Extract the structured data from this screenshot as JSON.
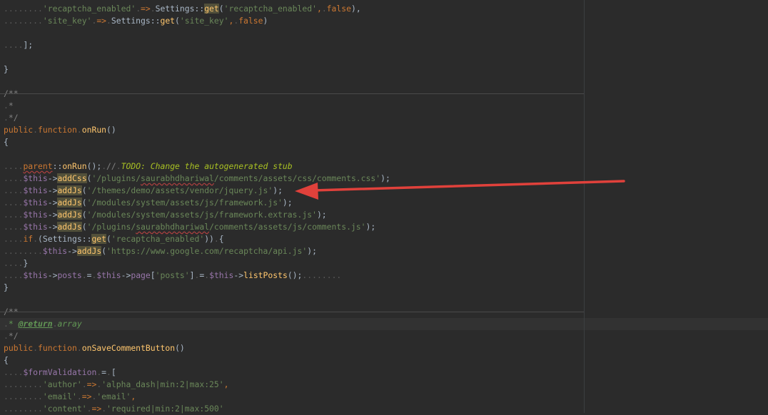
{
  "lines": [
    [
      [
        "ws",
        "........"
      ],
      [
        "str",
        "'recaptcha_enabled'"
      ],
      [
        "ws",
        "."
      ],
      [
        "kw",
        "=>"
      ],
      [
        "ws",
        "."
      ],
      [
        "def",
        "Settings::"
      ],
      [
        "fn hl",
        "get"
      ],
      [
        "def",
        "("
      ],
      [
        "str",
        "'recaptcha_enabled'"
      ],
      [
        "kw",
        ","
      ],
      [
        "ws",
        "."
      ],
      [
        "kw",
        "false"
      ],
      [
        "def",
        "),"
      ]
    ],
    [
      [
        "ws",
        "........"
      ],
      [
        "str",
        "'site_key'"
      ],
      [
        "ws",
        "."
      ],
      [
        "kw",
        "=>"
      ],
      [
        "ws",
        "."
      ],
      [
        "def",
        "Settings::"
      ],
      [
        "fn",
        "get"
      ],
      [
        "def",
        "("
      ],
      [
        "str",
        "'site_key'"
      ],
      [
        "kw",
        ","
      ],
      [
        "ws",
        "."
      ],
      [
        "kw",
        "false"
      ],
      [
        "def",
        ")"
      ]
    ],
    [],
    [
      [
        "ws",
        "...."
      ],
      [
        "def",
        "];"
      ]
    ],
    [],
    [
      [
        "def",
        "}"
      ]
    ],
    [],
    [
      [
        "cmt",
        "/**"
      ]
    ],
    [
      [
        "ws",
        "."
      ],
      [
        "cmt",
        "*"
      ]
    ],
    [
      [
        "ws",
        "."
      ],
      [
        "cmt",
        "*/"
      ]
    ],
    [
      [
        "kw",
        "public"
      ],
      [
        "ws",
        "."
      ],
      [
        "kw",
        "function"
      ],
      [
        "ws",
        "."
      ],
      [
        "fn",
        "onRun"
      ],
      [
        "def",
        "()"
      ]
    ],
    [
      [
        "def",
        "{"
      ]
    ],
    [],
    [
      [
        "ws",
        "...."
      ],
      [
        "kw typo",
        "parent"
      ],
      [
        "def",
        "::"
      ],
      [
        "fn",
        "onRun"
      ],
      [
        "def",
        "();"
      ],
      [
        "ws",
        "."
      ],
      [
        "cmt",
        "//"
      ],
      [
        "ws",
        "."
      ],
      [
        "todo",
        "TODO: Change the autogenerated stub"
      ]
    ],
    [
      [
        "ws",
        "...."
      ],
      [
        "var",
        "$this"
      ],
      [
        "def",
        "->"
      ],
      [
        "fn hl",
        "addCss"
      ],
      [
        "def",
        "("
      ],
      [
        "str",
        "'/plugins/"
      ],
      [
        "str typo",
        "saurabhdhariwal"
      ],
      [
        "str",
        "/comments/assets/css/comments.css'"
      ],
      [
        "def",
        ");"
      ]
    ],
    [
      [
        "ws",
        "...."
      ],
      [
        "var",
        "$this"
      ],
      [
        "def",
        "->"
      ],
      [
        "fn hl",
        "addJs"
      ],
      [
        "def",
        "("
      ],
      [
        "str",
        "'/themes/demo/assets/vendor/jquery.js'"
      ],
      [
        "def",
        ");"
      ]
    ],
    [
      [
        "ws",
        "...."
      ],
      [
        "var",
        "$this"
      ],
      [
        "def",
        "->"
      ],
      [
        "fn hl",
        "addJs"
      ],
      [
        "def",
        "("
      ],
      [
        "str",
        "'/modules/system/assets/js/framework.js'"
      ],
      [
        "def",
        ");"
      ]
    ],
    [
      [
        "ws",
        "...."
      ],
      [
        "var",
        "$this"
      ],
      [
        "def",
        "->"
      ],
      [
        "fn hl",
        "addJs"
      ],
      [
        "def",
        "("
      ],
      [
        "str",
        "'/modules/system/assets/js/framework.extras.js'"
      ],
      [
        "def",
        ");"
      ]
    ],
    [
      [
        "ws",
        "...."
      ],
      [
        "var",
        "$this"
      ],
      [
        "def",
        "->"
      ],
      [
        "fn hl",
        "addJs"
      ],
      [
        "def",
        "("
      ],
      [
        "str",
        "'/plugins/"
      ],
      [
        "str typo",
        "saurabhdhariwal"
      ],
      [
        "str",
        "/comments/assets/js/comments.js'"
      ],
      [
        "def",
        ");"
      ]
    ],
    [
      [
        "ws",
        "...."
      ],
      [
        "kw",
        "if"
      ],
      [
        "ws",
        "."
      ],
      [
        "def",
        "(Settings::"
      ],
      [
        "fn hl",
        "get"
      ],
      [
        "def",
        "("
      ],
      [
        "str",
        "'recaptcha_enabled'"
      ],
      [
        "def",
        "))"
      ],
      [
        "ws",
        "."
      ],
      [
        "def",
        "{"
      ]
    ],
    [
      [
        "ws",
        "........"
      ],
      [
        "var",
        "$this"
      ],
      [
        "def",
        "->"
      ],
      [
        "fn hl",
        "addJs"
      ],
      [
        "def",
        "("
      ],
      [
        "str",
        "'https://www.google.com/recaptcha/api.js'"
      ],
      [
        "def",
        ");"
      ]
    ],
    [
      [
        "ws",
        "...."
      ],
      [
        "def",
        "}"
      ]
    ],
    [
      [
        "ws",
        "...."
      ],
      [
        "var",
        "$this"
      ],
      [
        "def",
        "->"
      ],
      [
        "var",
        "posts"
      ],
      [
        "ws",
        "."
      ],
      [
        "def",
        "="
      ],
      [
        "ws",
        "."
      ],
      [
        "var",
        "$this"
      ],
      [
        "def",
        "->"
      ],
      [
        "var",
        "page"
      ],
      [
        "def",
        "["
      ],
      [
        "str",
        "'posts'"
      ],
      [
        "def",
        "]"
      ],
      [
        "ws",
        "."
      ],
      [
        "def",
        "="
      ],
      [
        "ws",
        "."
      ],
      [
        "var",
        "$this"
      ],
      [
        "def",
        "->"
      ],
      [
        "fn",
        "listPosts"
      ],
      [
        "def",
        "();"
      ],
      [
        "ws",
        "........"
      ]
    ],
    [
      [
        "def",
        "}"
      ]
    ],
    [],
    [
      [
        "cmt",
        "/**"
      ]
    ],
    [
      [
        "ws",
        "."
      ],
      [
        "doc",
        "* "
      ],
      [
        "doctag",
        "@return"
      ],
      [
        "ws",
        "."
      ],
      [
        "doc",
        "array"
      ]
    ],
    [
      [
        "ws",
        "."
      ],
      [
        "cmt",
        "*/"
      ]
    ],
    [
      [
        "kw",
        "public"
      ],
      [
        "ws",
        "."
      ],
      [
        "kw",
        "function"
      ],
      [
        "ws",
        "."
      ],
      [
        "fn",
        "onSaveCommentButton"
      ],
      [
        "def",
        "()"
      ]
    ],
    [
      [
        "def",
        "{"
      ]
    ],
    [
      [
        "ws",
        "...."
      ],
      [
        "var",
        "$formValidation"
      ],
      [
        "ws",
        "."
      ],
      [
        "def",
        "="
      ],
      [
        "ws",
        "."
      ],
      [
        "def",
        "["
      ]
    ],
    [
      [
        "ws",
        "........"
      ],
      [
        "str",
        "'author'"
      ],
      [
        "ws",
        "."
      ],
      [
        "kw",
        "=>"
      ],
      [
        "ws",
        "."
      ],
      [
        "str",
        "'alpha_dash|min:2|max:25'"
      ],
      [
        "kw",
        ","
      ]
    ],
    [
      [
        "ws",
        "........"
      ],
      [
        "str",
        "'email'"
      ],
      [
        "ws",
        "."
      ],
      [
        "kw",
        "=>"
      ],
      [
        "ws",
        "."
      ],
      [
        "str",
        "'email'"
      ],
      [
        "kw",
        ","
      ]
    ],
    [
      [
        "ws",
        "........"
      ],
      [
        "str",
        "'content'"
      ],
      [
        "ws",
        "."
      ],
      [
        "kw",
        "=>"
      ],
      [
        "ws",
        "."
      ],
      [
        "str",
        "'required|min:2|max:500'"
      ]
    ]
  ],
  "current_line": 26,
  "separators_after": [
    6,
    24
  ],
  "annotation": {
    "type": "arrow",
    "color": "#e0413b",
    "points_to_line": 15
  }
}
